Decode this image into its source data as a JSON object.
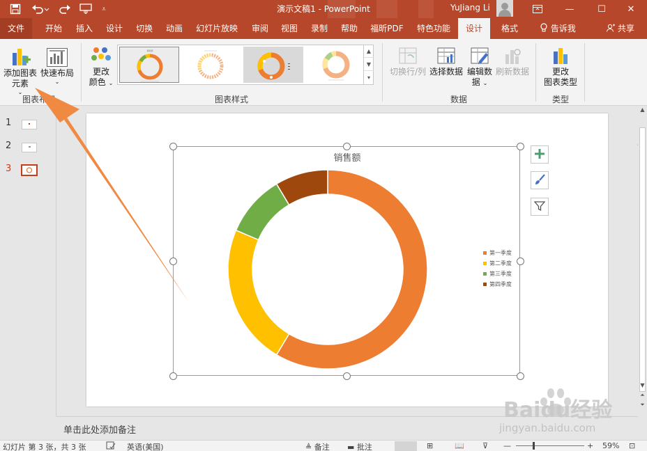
{
  "app": {
    "title": "演示文稿1  -  PowerPoint",
    "user": "YuJiang Li",
    "brand_color": "#b7472a"
  },
  "quick_access": {
    "save_icon": "save-icon",
    "undo_icon": "undo-icon",
    "redo_icon": "redo-icon",
    "present_icon": "start-slideshow-icon",
    "customize_icon": "customize-toolbar-icon"
  },
  "window_buttons": {
    "ribbon_options_icon": "ribbon-display-options-icon",
    "minimize_label": "—",
    "restore_label": "☐",
    "close_label": "✕"
  },
  "tabs": [
    {
      "label": "文件"
    },
    {
      "label": "开始"
    },
    {
      "label": "插入"
    },
    {
      "label": "设计"
    },
    {
      "label": "切换"
    },
    {
      "label": "动画"
    },
    {
      "label": "幻灯片放映"
    },
    {
      "label": "审阅"
    },
    {
      "label": "视图"
    },
    {
      "label": "录制"
    },
    {
      "label": "帮助"
    },
    {
      "label": "福昕PDF"
    },
    {
      "label": "特色功能"
    },
    {
      "label": "设计"
    },
    {
      "label": "格式"
    }
  ],
  "tell_me": "告诉我",
  "share": "共享",
  "ribbon": {
    "add_element_line1": "添加图表",
    "add_element_line2": "元素",
    "quick_layout": "快速布局",
    "layout_group_label": "图表布局",
    "change_colors_line1": "更改",
    "change_colors_line2": "颜色",
    "chart_styles_group_label": "图表样式",
    "switch_row_col": "切换行/列",
    "select_data": "选择数据",
    "edit_data_line1": "编辑数",
    "edit_data_line2": "据",
    "refresh_data": "刷新数据",
    "data_group_label": "数据",
    "change_type_line1": "更改",
    "change_type_line2": "图表类型",
    "type_group_label": "类型"
  },
  "slides": [
    {
      "number": "1"
    },
    {
      "number": "2"
    },
    {
      "number": "3"
    }
  ],
  "chart_data": {
    "type": "pie",
    "subtype": "doughnut",
    "title": "销售额",
    "categories": [
      "第一季度",
      "第二季度",
      "第三季度",
      "第四季度"
    ],
    "values": [
      8.2,
      3.2,
      1.4,
      1.2
    ],
    "colors": [
      "#ed7d31",
      "#ffc000",
      "#70ad47",
      "#9e480e"
    ],
    "legend_position": "right"
  },
  "chart_tools": {
    "elements_icon": "plus-icon",
    "styles_icon": "brush-icon",
    "filter_icon": "filter-icon"
  },
  "notes_placeholder": "单击此处添加备注",
  "status": {
    "slide_info": "幻灯片 第 3 张，共 3 张",
    "language": "英语(美国)",
    "notes": "备注",
    "comments": "批注",
    "zoom": "59%"
  },
  "watermark": {
    "text": "Baidu经验",
    "url": "jingyan.baidu.com"
  }
}
